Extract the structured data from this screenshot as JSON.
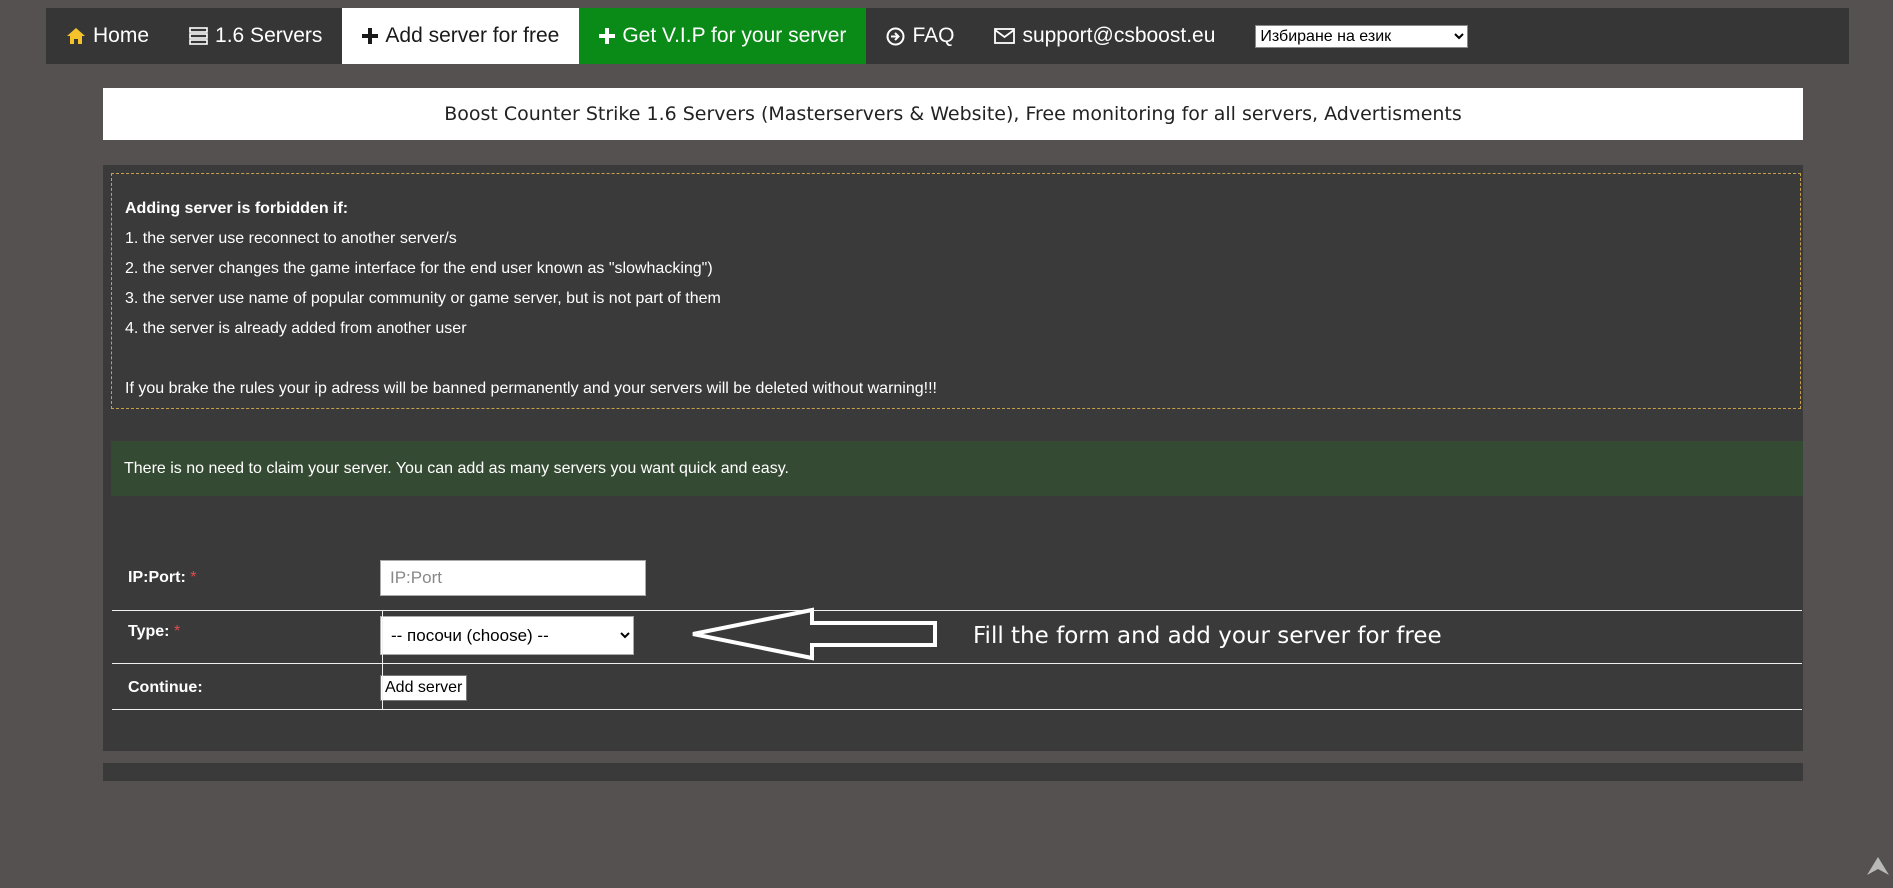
{
  "nav": {
    "items": [
      {
        "label": "Home",
        "icon": "home-icon"
      },
      {
        "label": "1.6 Servers",
        "icon": "server-list-icon"
      },
      {
        "label": "Add server for free",
        "icon": "plus-icon",
        "active": true
      },
      {
        "label": "Get V.I.P for your server",
        "icon": "plus-icon"
      },
      {
        "label": "FAQ",
        "icon": "arrow-circle-icon"
      },
      {
        "label": "support@csboost.eu",
        "icon": "envelope-icon"
      }
    ],
    "language_select": "Избиране на език"
  },
  "banner": {
    "text": "Boost Counter Strike 1.6 Servers (Masterservers & Website), Free monitoring for all servers, Advertisments"
  },
  "rules": {
    "heading": "Adding server is forbidden if:",
    "items": [
      "1. the server use reconnect to another server/s",
      "2. the server changes the game interface for the end user known as \"slowhacking\")",
      "3. the server use name of popular community or game server, but is not part of them",
      "4. the server is already added from another user"
    ],
    "warning": "If you brake the rules your ip adress will be banned permanently and your servers will be deleted without warning!!!"
  },
  "notice": "There is no need to claim your server. You can add as many servers you want quick and easy.",
  "form": {
    "ip_label": "IP:Port:",
    "ip_placeholder": "IP:Port",
    "ip_value": "",
    "type_label": "Type:",
    "type_selected": "-- посочи (choose) --",
    "continue_label": "Continue:",
    "submit_label": "Add server",
    "required_mark": "*"
  },
  "hint": "Fill the form and add your server for free",
  "colors": {
    "background": "#545150",
    "nav": "#363636",
    "vip": "#0a8a16",
    "notice": "#354a33",
    "dashed_border": "#c9a04a"
  }
}
